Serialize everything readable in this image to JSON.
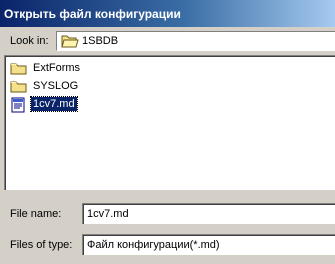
{
  "dialog": {
    "title": "Открыть файл конфигурации"
  },
  "look_in": {
    "label": "Look in:",
    "value": "1SBDB",
    "icon": "folder-open-icon"
  },
  "file_list": {
    "items": [
      {
        "name": "ExtForms",
        "icon": "folder-icon",
        "selected": false
      },
      {
        "name": "SYSLOG",
        "icon": "folder-icon",
        "selected": false
      },
      {
        "name": "1cv7.md",
        "icon": "md-file-icon",
        "selected": true
      }
    ]
  },
  "file_name": {
    "label": "File name:",
    "value": "1cv7.md"
  },
  "files_of_type": {
    "label": "Files of type:",
    "value": "Файл конфигурации(*.md)"
  },
  "colors": {
    "title_bar_start": "#0a246a",
    "title_bar_end": "#a6caf0",
    "selection": "#0a246a",
    "dialog_face": "#d4d0c8"
  }
}
